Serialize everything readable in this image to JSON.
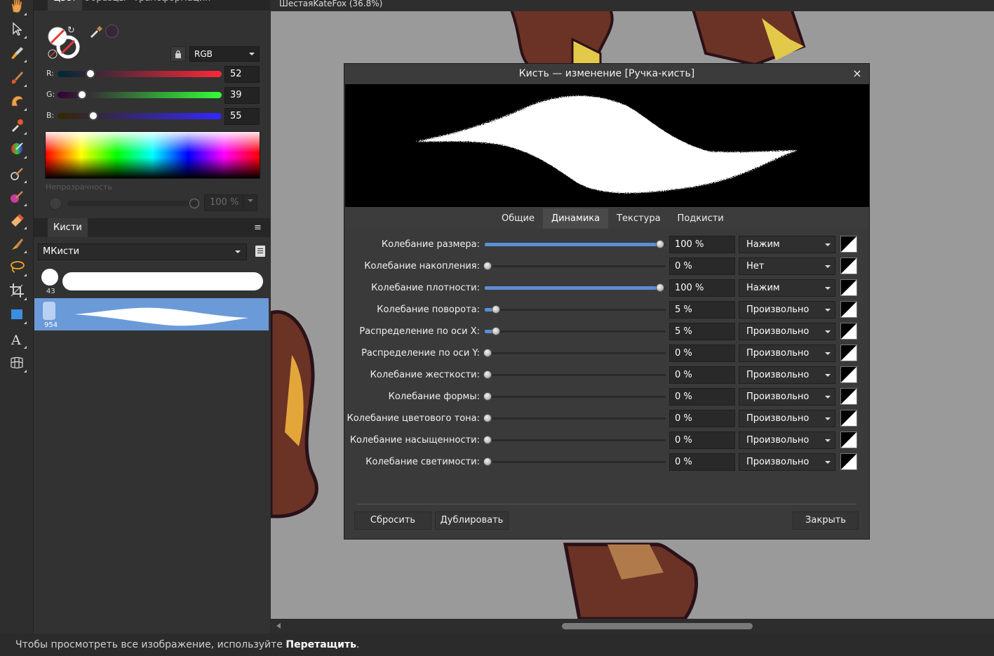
{
  "doc_title": "ШестаяKateFox (36.8%)",
  "panel": {
    "tabs": [
      "Цвет",
      "Образцы",
      "Трансформация"
    ],
    "color": {
      "mode": "RGB",
      "r_label": "R:",
      "g_label": "G:",
      "b_label": "B:",
      "r": "52",
      "g": "39",
      "b": "55",
      "r_fraction": 0.2,
      "g_fraction": 0.15,
      "b_fraction": 0.22,
      "opacity_label": "Непрозрачность",
      "opacity": "100 %"
    },
    "brushes": {
      "tab": "Кисти",
      "category": "МКисти",
      "items": [
        {
          "size": "43"
        },
        {
          "size": "954"
        }
      ]
    }
  },
  "dialog": {
    "title": "Кисть — изменение [Ручка-кисть]",
    "close": "×",
    "tabs": [
      "Общие",
      "Динамика",
      "Текстура",
      "Подкисти"
    ],
    "active_tab": "Динамика",
    "rows": [
      {
        "label": "Колебание размера:",
        "value": "100 %",
        "pct": 100,
        "mode": "Нажим"
      },
      {
        "label": "Колебание накопления:",
        "value": "0 %",
        "pct": 0,
        "mode": "Нет"
      },
      {
        "label": "Колебание плотности:",
        "value": "100 %",
        "pct": 100,
        "mode": "Нажим"
      },
      {
        "label": "Колебание поворота:",
        "value": "5 %",
        "pct": 5,
        "mode": "Произвольно"
      },
      {
        "label": "Распределение по оси X:",
        "value": "5 %",
        "pct": 5,
        "mode": "Произвольно"
      },
      {
        "label": "Распределение по оси Y:",
        "value": "0 %",
        "pct": 0,
        "mode": "Произвольно"
      },
      {
        "label": "Колебание жесткости:",
        "value": "0 %",
        "pct": 0,
        "mode": "Произвольно"
      },
      {
        "label": "Колебание формы:",
        "value": "0 %",
        "pct": 0,
        "mode": "Произвольно"
      },
      {
        "label": "Колебание цветового тона:",
        "value": "0 %",
        "pct": 0,
        "mode": "Произвольно"
      },
      {
        "label": "Колебание насыщенности:",
        "value": "0 %",
        "pct": 0,
        "mode": "Произвольно"
      },
      {
        "label": "Колебание светимости:",
        "value": "0 %",
        "pct": 0,
        "mode": "Произвольно"
      }
    ],
    "buttons": {
      "reset": "Сбросить",
      "duplicate": "Дублировать",
      "close": "Закрыть"
    }
  },
  "status": {
    "text": "Чтобы просмотреть все изображение, используйте ",
    "bold": "Перетащить",
    "end": "."
  },
  "colors": {
    "accent": "#5b8fd6",
    "current_color": "#342737"
  }
}
